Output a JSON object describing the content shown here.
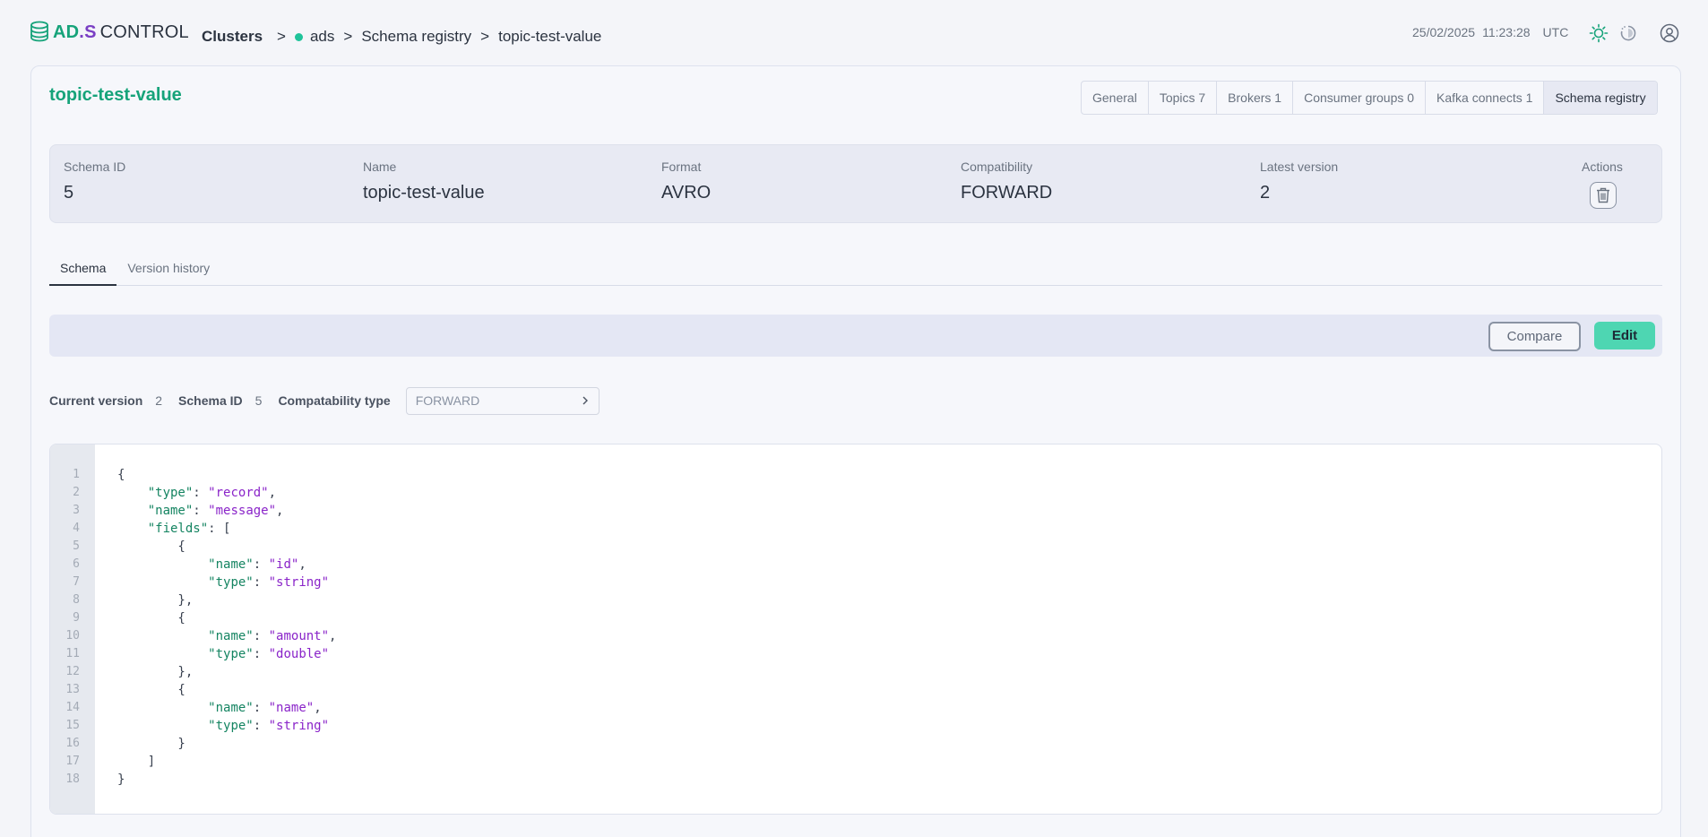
{
  "app": {
    "logo": {
      "ad": "AD",
      "dot": ".",
      "s": "S",
      "control": "CONTROL"
    }
  },
  "breadcrumb": {
    "clusters": "Clusters",
    "separator": ">",
    "cluster": "ads",
    "section": "Schema registry",
    "current": "topic-test-value"
  },
  "header": {
    "date": "25/02/2025",
    "time": "11:23:28",
    "tz": "UTC"
  },
  "page": {
    "title": "topic-test-value"
  },
  "cluster_tabs": [
    {
      "label": "General",
      "active": false
    },
    {
      "label": "Topics 7",
      "active": false
    },
    {
      "label": "Brokers 1",
      "active": false
    },
    {
      "label": "Consumer groups 0",
      "active": false
    },
    {
      "label": "Kafka connects 1",
      "active": false
    },
    {
      "label": "Schema registry",
      "active": true
    }
  ],
  "summary": {
    "schema_id": {
      "label": "Schema ID",
      "value": "5"
    },
    "name": {
      "label": "Name",
      "value": "topic-test-value"
    },
    "format": {
      "label": "Format",
      "value": "AVRO"
    },
    "compatibility": {
      "label": "Compatibility",
      "value": "FORWARD"
    },
    "latest_version": {
      "label": "Latest version",
      "value": "2"
    },
    "actions": {
      "label": "Actions"
    }
  },
  "sub_tabs": [
    {
      "label": "Schema",
      "active": true
    },
    {
      "label": "Version history",
      "active": false
    }
  ],
  "toolbar": {
    "compare_label": "Compare",
    "edit_label": "Edit"
  },
  "version_info": {
    "current_version_label": "Current version",
    "current_version_value": "2",
    "schema_id_label": "Schema ID",
    "schema_id_value": "5",
    "compat_type_label": "Compatability type",
    "compat_type_value": "FORWARD"
  },
  "colors": {
    "brand_green": "#16a37a",
    "brand_purple": "#7a3fc4",
    "edit_button": "#4ed6b2",
    "status_dot": "#1fc39a",
    "json_key": "#148461",
    "json_string": "#8a24c9"
  },
  "icons": [
    "sun-icon",
    "history-icon",
    "user-account-icon",
    "trash-icon",
    "chevron-right-icon",
    "status-dot-icon"
  ],
  "code": {
    "lines": [
      "{",
      "    \"type\": \"record\",",
      "    \"name\": \"message\",",
      "    \"fields\": [",
      "        {",
      "            \"name\": \"id\",",
      "            \"type\": \"string\"",
      "        },",
      "        {",
      "            \"name\": \"amount\",",
      "            \"type\": \"double\"",
      "        },",
      "        {",
      "            \"name\": \"name\",",
      "            \"type\": \"string\"",
      "        }",
      "    ]",
      "}"
    ]
  }
}
